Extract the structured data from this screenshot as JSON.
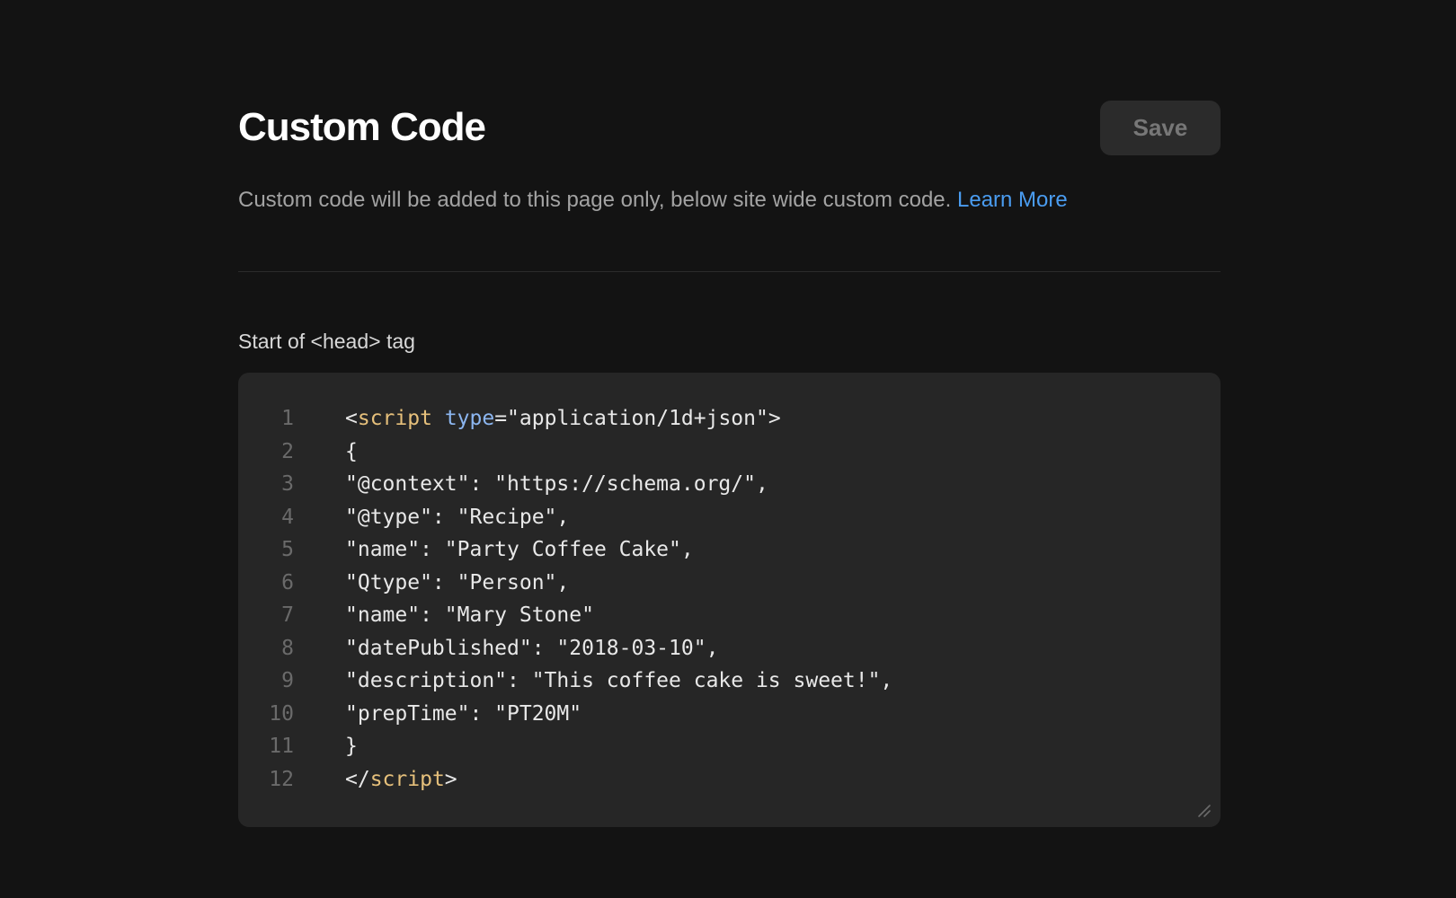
{
  "header": {
    "title": "Custom Code",
    "save_label": "Save"
  },
  "description": {
    "text": "Custom code will be added to this page only, below site wide custom code. ",
    "link_label": "Learn More"
  },
  "section": {
    "label": "Start of <head> tag"
  },
  "editor": {
    "lines": [
      {
        "num": "1",
        "parts": [
          {
            "t": "<"
          },
          {
            "t": "script",
            "c": "tag"
          },
          {
            "t": " "
          },
          {
            "t": "type",
            "c": "attr"
          },
          {
            "t": "=\"application/1d+json\">"
          }
        ]
      },
      {
        "num": "2",
        "parts": [
          {
            "t": "{"
          }
        ]
      },
      {
        "num": "3",
        "parts": [
          {
            "t": "\"@context\": \"https://schema.org/\","
          }
        ]
      },
      {
        "num": "4",
        "parts": [
          {
            "t": "\"@type\": \"Recipe\","
          }
        ]
      },
      {
        "num": "5",
        "parts": [
          {
            "t": "\"name\": \"Party Coffee Cake\","
          }
        ]
      },
      {
        "num": "6",
        "parts": [
          {
            "t": "\"Qtype\": \"Person\","
          }
        ]
      },
      {
        "num": "7",
        "parts": [
          {
            "t": "\"name\": \"Mary Stone\""
          }
        ]
      },
      {
        "num": "8",
        "parts": [
          {
            "t": "\"datePublished\": \"2018-03-10\","
          }
        ]
      },
      {
        "num": "9",
        "parts": [
          {
            "t": "\"description\": \"This coffee cake is sweet!\","
          }
        ]
      },
      {
        "num": "10",
        "parts": [
          {
            "t": "\"prepTime\": \"PT20M\""
          }
        ]
      },
      {
        "num": "11",
        "parts": [
          {
            "t": "}"
          }
        ]
      },
      {
        "num": "12",
        "parts": [
          {
            "t": "</"
          },
          {
            "t": "script",
            "c": "tag"
          },
          {
            "t": ">"
          }
        ]
      }
    ]
  },
  "colors": {
    "background": "#131313",
    "editor_background": "#262626",
    "link": "#4a9cf0",
    "tag": "#e6c07b",
    "attribute": "#8cb6f0"
  },
  "icons": {
    "resize_handle": "resize-handle-icon"
  }
}
